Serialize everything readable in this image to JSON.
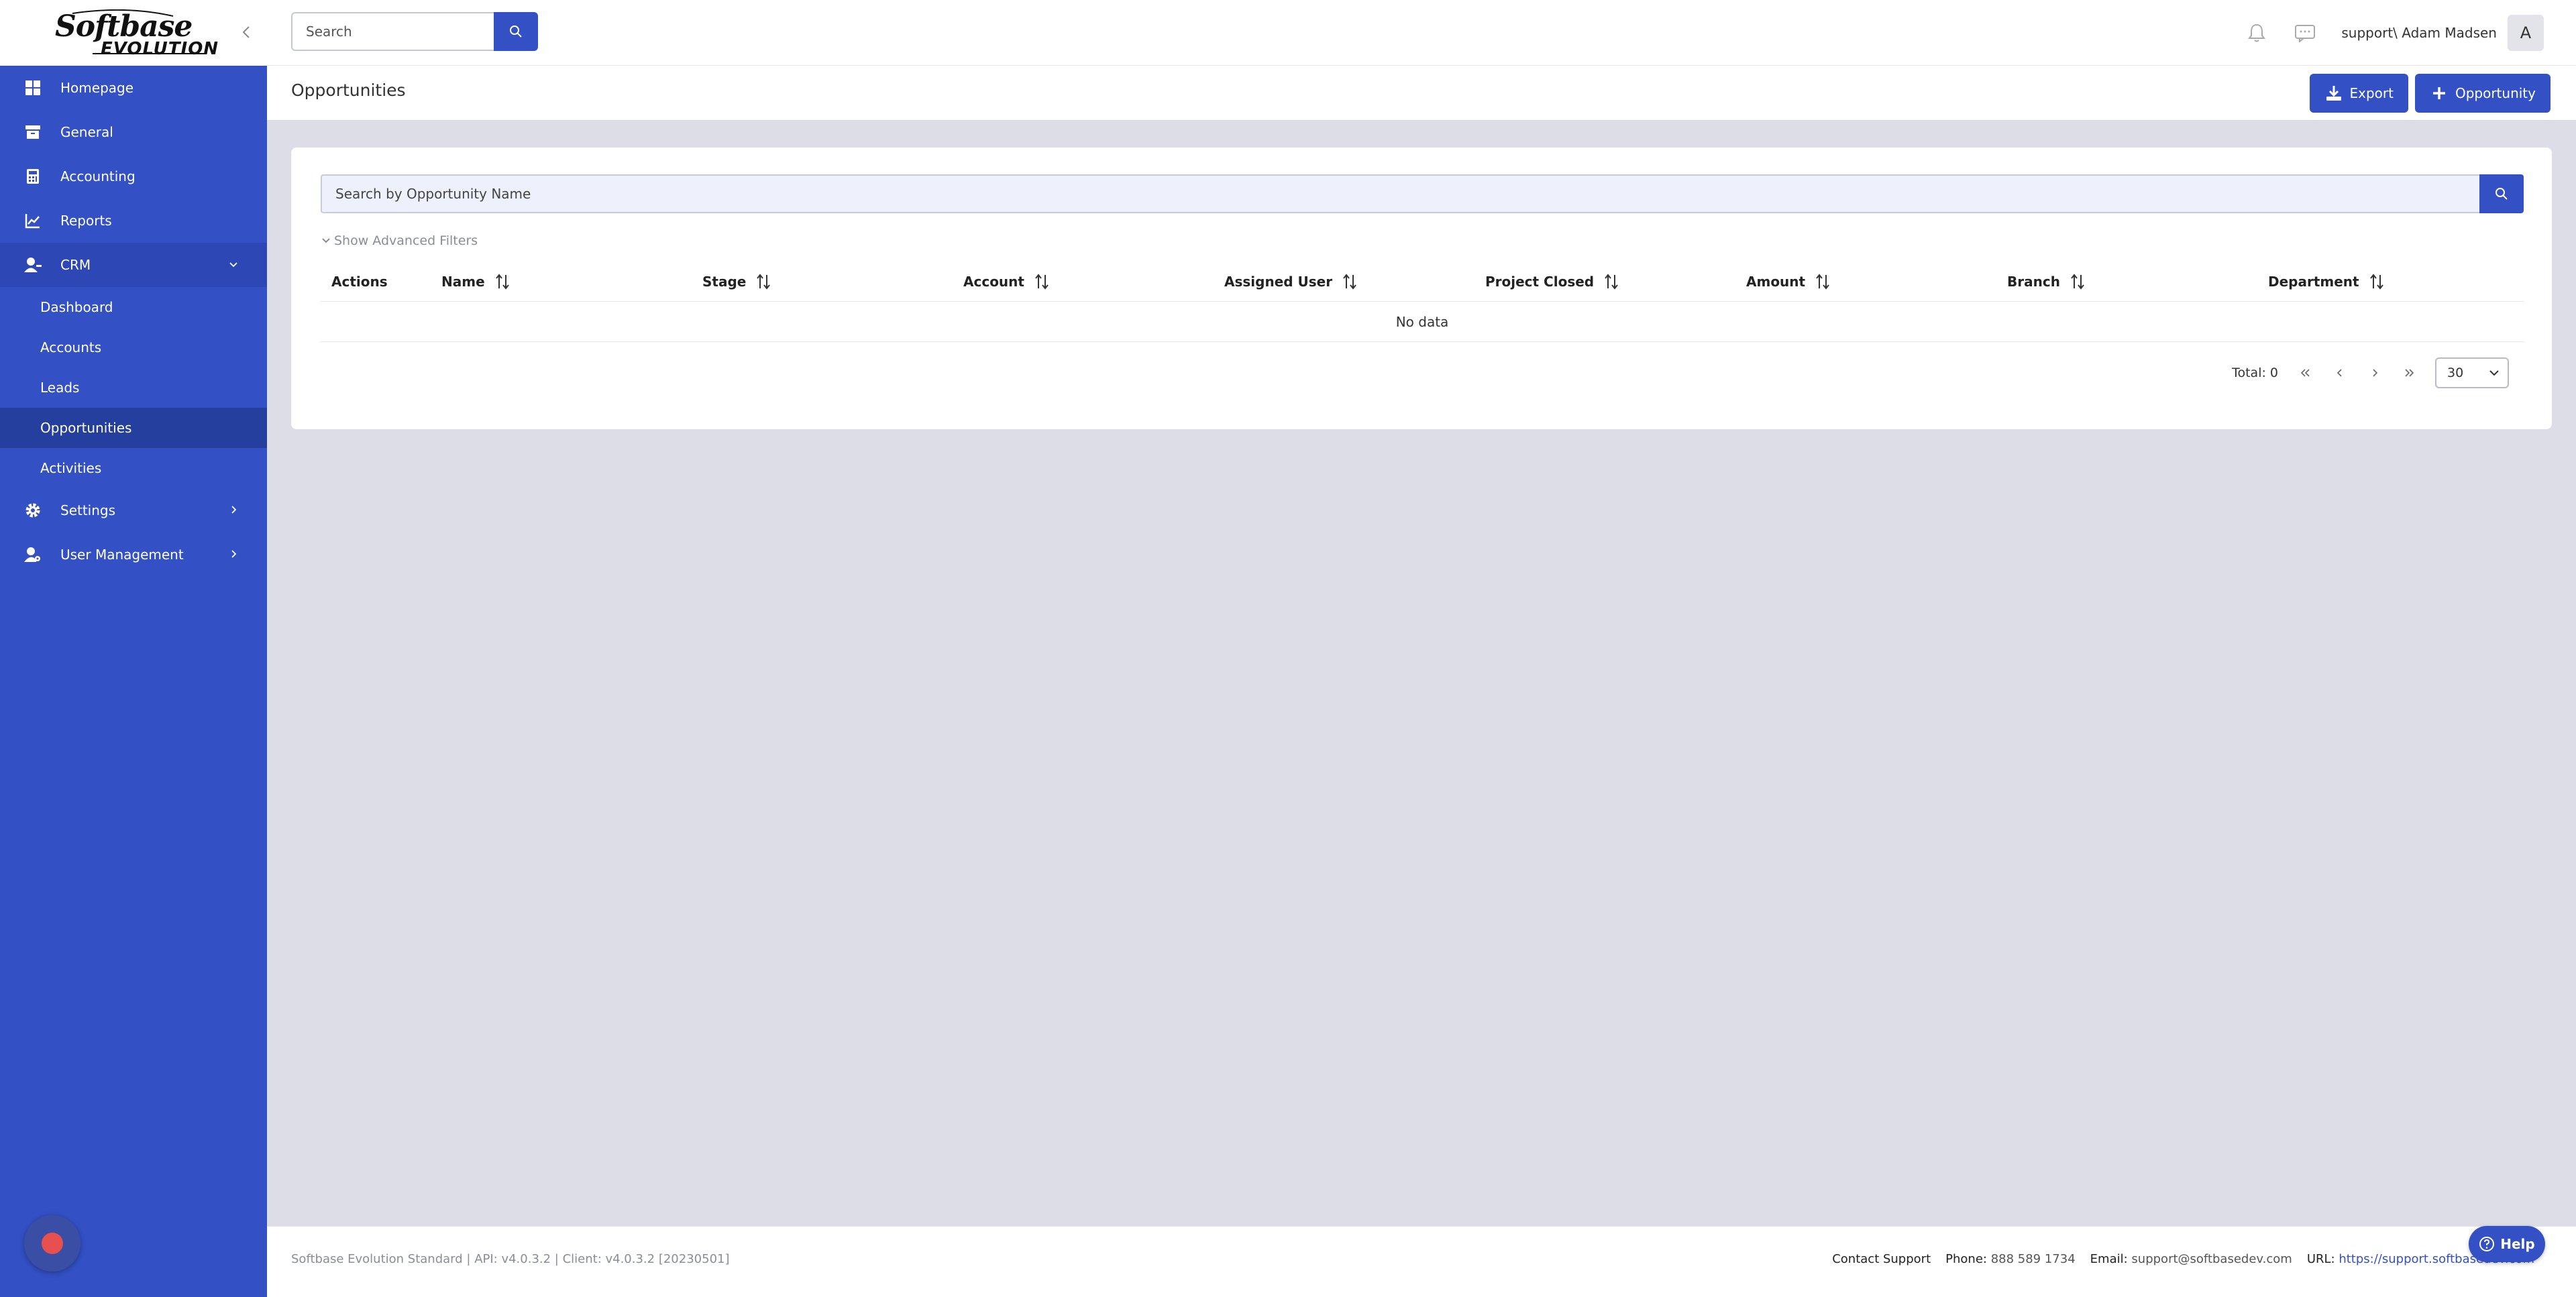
{
  "app": {
    "logo_text_top": "Softbase",
    "logo_text_bottom": "EVOLUTION"
  },
  "sidebar": {
    "items": [
      {
        "label": "Homepage",
        "icon": "dashboard-grid-icon"
      },
      {
        "label": "General",
        "icon": "archive-box-icon"
      },
      {
        "label": "Accounting",
        "icon": "calculator-icon"
      },
      {
        "label": "Reports",
        "icon": "chart-line-icon"
      },
      {
        "label": "CRM",
        "icon": "user-icon",
        "expanded": true
      },
      {
        "label": "Settings",
        "icon": "gear-icon"
      },
      {
        "label": "User Management",
        "icon": "user-settings-icon"
      }
    ],
    "crm_sub_items": [
      {
        "label": "Dashboard"
      },
      {
        "label": "Accounts"
      },
      {
        "label": "Leads"
      },
      {
        "label": "Opportunities",
        "active": true
      },
      {
        "label": "Activities"
      }
    ]
  },
  "header": {
    "search_placeholder": "Search",
    "user_name": "support\\ Adam Madsen",
    "avatar_letter": "A"
  },
  "page": {
    "title": "Opportunities",
    "export_label": "Export",
    "add_label": "Opportunity"
  },
  "main": {
    "search_placeholder": "Search by Opportunity Name",
    "advanced_filters_label": "Show Advanced Filters",
    "columns": [
      "Actions",
      "Name",
      "Stage",
      "Account",
      "Assigned User",
      "Project Closed",
      "Amount",
      "Branch",
      "Department"
    ],
    "empty_text": "No data",
    "total_label": "Total: 0",
    "page_size": "30"
  },
  "footer": {
    "version_text": "Softbase Evolution Standard | API: v4.0.3.2 | Client: v4.0.3.2 [20230501]",
    "contact_label": "Contact Support",
    "phone_label": "Phone:",
    "phone_value": "888 589 1734",
    "email_label": "Email:",
    "email_value": "support@softbasedev.com",
    "url_label": "URL:",
    "url_value": "https://support.softbasedev.com",
    "help_label": "Help"
  },
  "colors": {
    "primary": "#3350c4",
    "sidebar_active": "#253f9e",
    "page_bg": "#dcdde6"
  }
}
